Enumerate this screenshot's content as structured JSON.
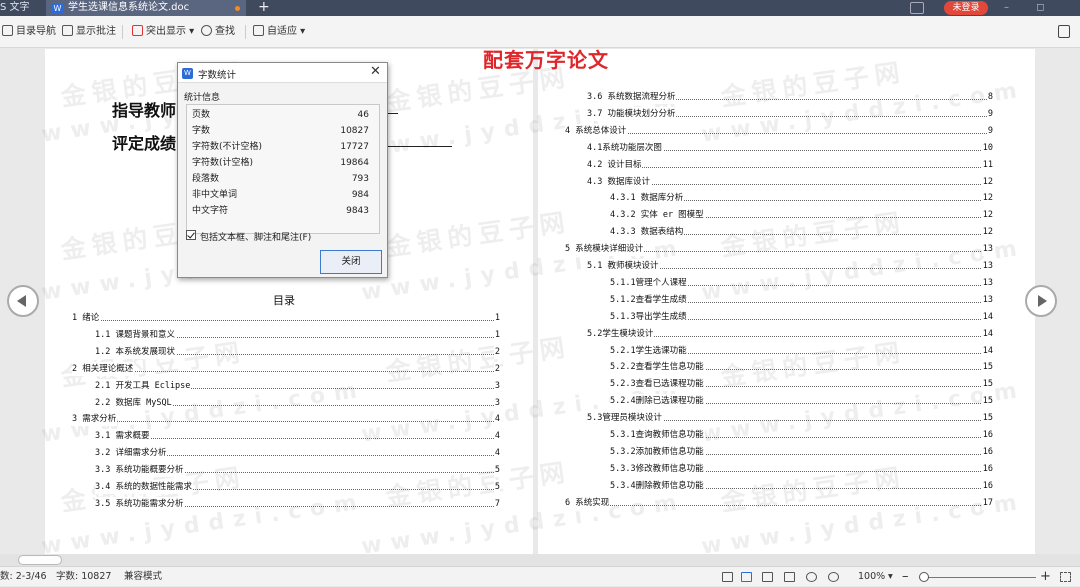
{
  "titlebar": {
    "app": "S 文字",
    "doc_tab": "学生选课信息系统论文.doc",
    "login": "未登录"
  },
  "toolbar": {
    "items": [
      "目录导航",
      "显示批注",
      "突出显示",
      "查找",
      "自适应"
    ]
  },
  "banner": "配套万字论文",
  "watermark": {
    "line1": "金银的豆子网",
    "line2": "www.jyddzi.com"
  },
  "cover": {
    "advisor": "指导教师:",
    "grade": "评定成绩:"
  },
  "toc_title": "目录",
  "toc_left": [
    {
      "t": "1  绪论",
      "p": "1",
      "indent": 0
    },
    {
      "t": "1.1  课题背景和意义",
      "p": "1",
      "indent": 1
    },
    {
      "t": "1.2  本系统发展现状",
      "p": "2",
      "indent": 1
    },
    {
      "t": "2 相关理论概述",
      "p": "2",
      "indent": 0
    },
    {
      "t": "2.1 开发工具 Eclipse",
      "p": "3",
      "indent": 1
    },
    {
      "t": "2.2 数据库 MySQL",
      "p": "3",
      "indent": 1
    },
    {
      "t": "3  需求分析",
      "p": "4",
      "indent": 0
    },
    {
      "t": "3.1  需求概要",
      "p": "4",
      "indent": 1
    },
    {
      "t": "3.2  详细需求分析",
      "p": "4",
      "indent": 1
    },
    {
      "t": "3.3  系统功能概要分析",
      "p": "5",
      "indent": 1
    },
    {
      "t": "3.4  系统的数据性能需求",
      "p": "5",
      "indent": 1
    },
    {
      "t": "3.5  系统功能需求分析",
      "p": "7",
      "indent": 1
    }
  ],
  "toc_right": [
    {
      "t": "3.6  系统数据流程分析",
      "p": "8",
      "indent": 1
    },
    {
      "t": "3.7  功能模块划分分析",
      "p": "9",
      "indent": 1
    },
    {
      "t": "4  系统总体设计",
      "p": "9",
      "indent": 0
    },
    {
      "t": "4.1系统功能层次图",
      "p": "10",
      "indent": 1
    },
    {
      "t": "4.2 设计目标",
      "p": "11",
      "indent": 1
    },
    {
      "t": "4.3 数据库设计",
      "p": "12",
      "indent": 1
    },
    {
      "t": "4.3.1 数据库分析",
      "p": "12",
      "indent": 2
    },
    {
      "t": "4.3.2 实体 er 图模型",
      "p": "12",
      "indent": 2
    },
    {
      "t": "4.3.3 数据表结构",
      "p": "12",
      "indent": 2
    },
    {
      "t": "5  系统模块详细设计",
      "p": "13",
      "indent": 0
    },
    {
      "t": "5.1  教师模块设计",
      "p": "13",
      "indent": 1
    },
    {
      "t": "5.1.1管理个人课程",
      "p": "13",
      "indent": 2
    },
    {
      "t": "5.1.2查看学生成绩",
      "p": "13",
      "indent": 2
    },
    {
      "t": "5.1.3导出学生成绩",
      "p": "14",
      "indent": 2
    },
    {
      "t": "5.2学生模块设计",
      "p": "14",
      "indent": 1
    },
    {
      "t": "5.2.1学生选课功能",
      "p": "14",
      "indent": 2
    },
    {
      "t": "5.2.2查看学生信息功能",
      "p": "15",
      "indent": 2
    },
    {
      "t": "5.2.3查看已选课程功能",
      "p": "15",
      "indent": 2
    },
    {
      "t": "5.2.4删除已选课程功能",
      "p": "15",
      "indent": 2
    },
    {
      "t": "5.3管理员模块设计",
      "p": "15",
      "indent": 1
    },
    {
      "t": "5.3.1查询教师信息功能",
      "p": "16",
      "indent": 2
    },
    {
      "t": "5.3.2添加教师信息功能",
      "p": "16",
      "indent": 2
    },
    {
      "t": "5.3.3修改教师信息功能",
      "p": "16",
      "indent": 2
    },
    {
      "t": "5.3.4删除教师信息功能",
      "p": "16",
      "indent": 2
    },
    {
      "t": "6  系统实现",
      "p": "17",
      "indent": 0
    }
  ],
  "dialog": {
    "title": "字数统计",
    "section": "统计信息",
    "rows": [
      {
        "label": "页数",
        "value": "46"
      },
      {
        "label": "字数",
        "value": "10827"
      },
      {
        "label": "字符数(不计空格)",
        "value": "17727"
      },
      {
        "label": "字符数(计空格)",
        "value": "19864"
      },
      {
        "label": "段落数",
        "value": "793"
      },
      {
        "label": "非中文单词",
        "value": "984"
      },
      {
        "label": "中文字符",
        "value": "9843"
      }
    ],
    "checkbox": "包括文本框、脚注和尾注(F)",
    "close_btn": "关闭"
  },
  "status": {
    "pages": "数: 2-3/46",
    "words": "字数: 10827",
    "mode": "兼容模式",
    "zoom": "100%"
  }
}
